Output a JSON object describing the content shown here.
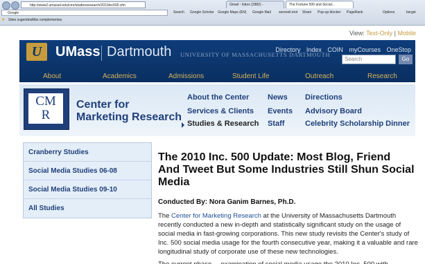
{
  "browser": {
    "url": "http://www2.umassd.edu/cmr/studiesresearch/2010inc500.cfm",
    "tabs": [
      "Gmail - Inbox (2882) - ",
      "The Fortune 500 and Social..."
    ],
    "toolbar": {
      "search_placeholder": "Google",
      "items": [
        "Search",
        "Google Scholar",
        "Google Maps (EN)",
        "Google Mail",
        "serenoil.mot",
        "Share",
        "Pop-up blocker",
        "PageRank",
        "Options",
        "bsrgst"
      ]
    },
    "bookmarks": [
      "Sites sugeridos",
      "Más complementos"
    ]
  },
  "page": {
    "view_prefix": "View:",
    "view_text_only": "Text-Only",
    "view_sep": "|",
    "view_mobile": "Mobile",
    "brand": {
      "logo_letter": "U",
      "umass": "UMass",
      "dartmouth": "Dartmouth",
      "university": "UNIVERSITY OF MASSACHUSETTS DARTMOUTH"
    },
    "quick_links": [
      "Directory",
      "Index",
      "COIN",
      "myCourses",
      "OneStop"
    ],
    "search_placeholder": "Search",
    "search_go": "Go",
    "main_nav": [
      "About",
      "Academics",
      "Admissions",
      "Student Life",
      "Outreach",
      "Research"
    ],
    "cmr": {
      "logo_top": "CM",
      "logo_bottom": "R",
      "name_line1": "Center for",
      "name_line2": "Marketing Research",
      "links": {
        "about": "About the Center",
        "services": "Services & Clients",
        "studies": "Studies & Research",
        "news": "News",
        "events": "Events",
        "staff": "Staff",
        "directions": "Directions",
        "advisory": "Advisory Board",
        "celebrity": "Celebrity Scholarship Dinner"
      }
    },
    "sidebar": [
      "Cranberry Studies",
      "Social Media Studies 06-08",
      "Social Media Studies 09-10",
      "All Studies"
    ],
    "article": {
      "title": "The 2010 Inc. 500 Update:  Most Blog, Friend And Tweet But Some Industries Still Shun Social Media",
      "byline": "Conducted By: Nora Ganim Barnes, Ph.D.",
      "body_prefix": "The ",
      "body_link": "Center for Marketing Research",
      "body_rest": " at the University of Massachusetts Dartmouth recently conducted a new in-depth and statistically significant study on the usage of social media in fast-growing corporations. This new study revisits the Center's study of Inc. 500 social media usage for the fourth consecutive year, making it a valuable and rare longitudinal study of corporate use of these new technologies.",
      "cutoff": "The current phase ... examination of social media usage the 2010 Inc. 500 with..."
    }
  }
}
